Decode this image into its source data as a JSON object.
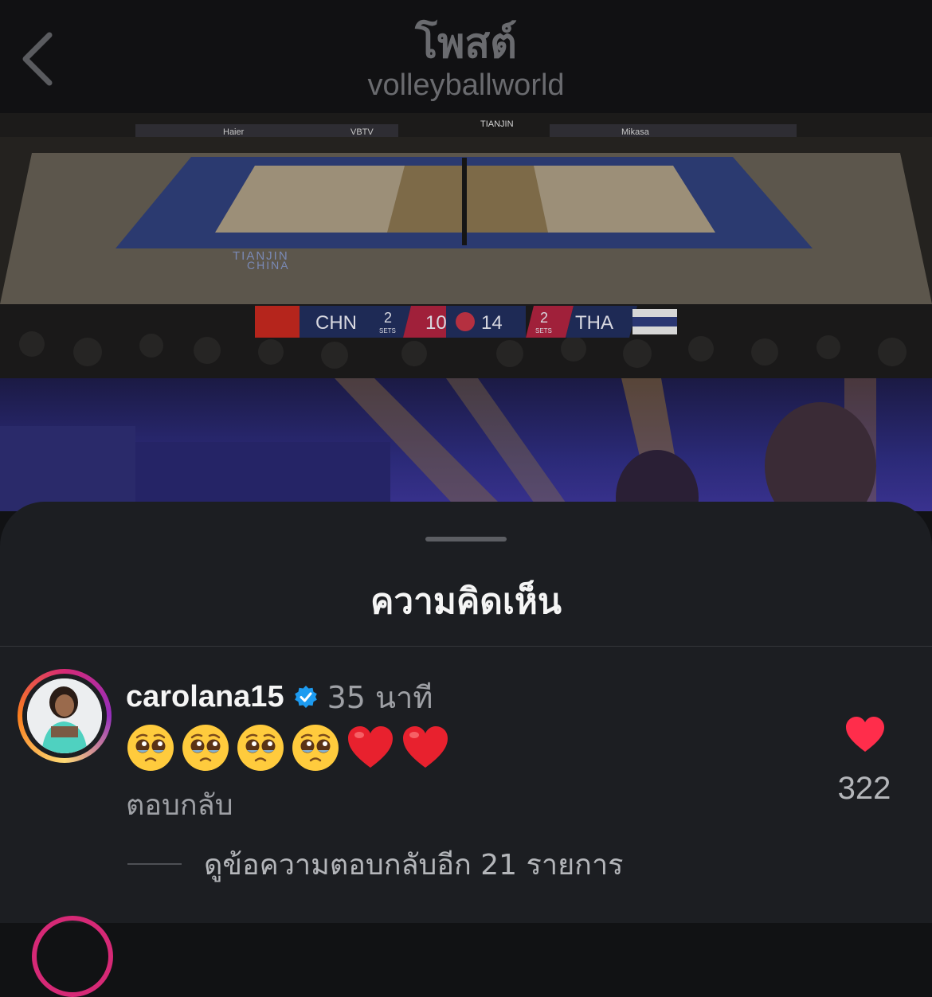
{
  "header": {
    "title": "โพสต์",
    "subtitle": "volleyballworld"
  },
  "media": {
    "sponsors": [
      "Haier",
      "VBTV",
      "TIANJIN",
      "Mikasa"
    ],
    "court_text": [
      "TIANJIN",
      "CHINA"
    ],
    "scoreboard": {
      "team_left": "CHN",
      "sets_left": "2",
      "sets_label": "SETS",
      "points_left": "10",
      "points_right": "14",
      "sets_right": "2",
      "team_right": "THA"
    }
  },
  "comments_sheet": {
    "title": "ความคิดเห็น",
    "comment": {
      "username": "carolana15",
      "verified": true,
      "timestamp": "35 นาที",
      "emojis": [
        "pleading-face",
        "pleading-face",
        "pleading-face",
        "pleading-face",
        "red-heart",
        "red-heart"
      ],
      "reply_label": "ตอบกลับ",
      "like_count": "322",
      "liked": true,
      "view_replies_label": "ดูข้อความตอบกลับอีก 21 รายการ"
    }
  },
  "colors": {
    "background": "#111214",
    "sheet": "#1c1e22",
    "muted_text": "#9ea0a5",
    "like_red": "#ff2d4b",
    "verified_blue": "#1d9bf0"
  }
}
